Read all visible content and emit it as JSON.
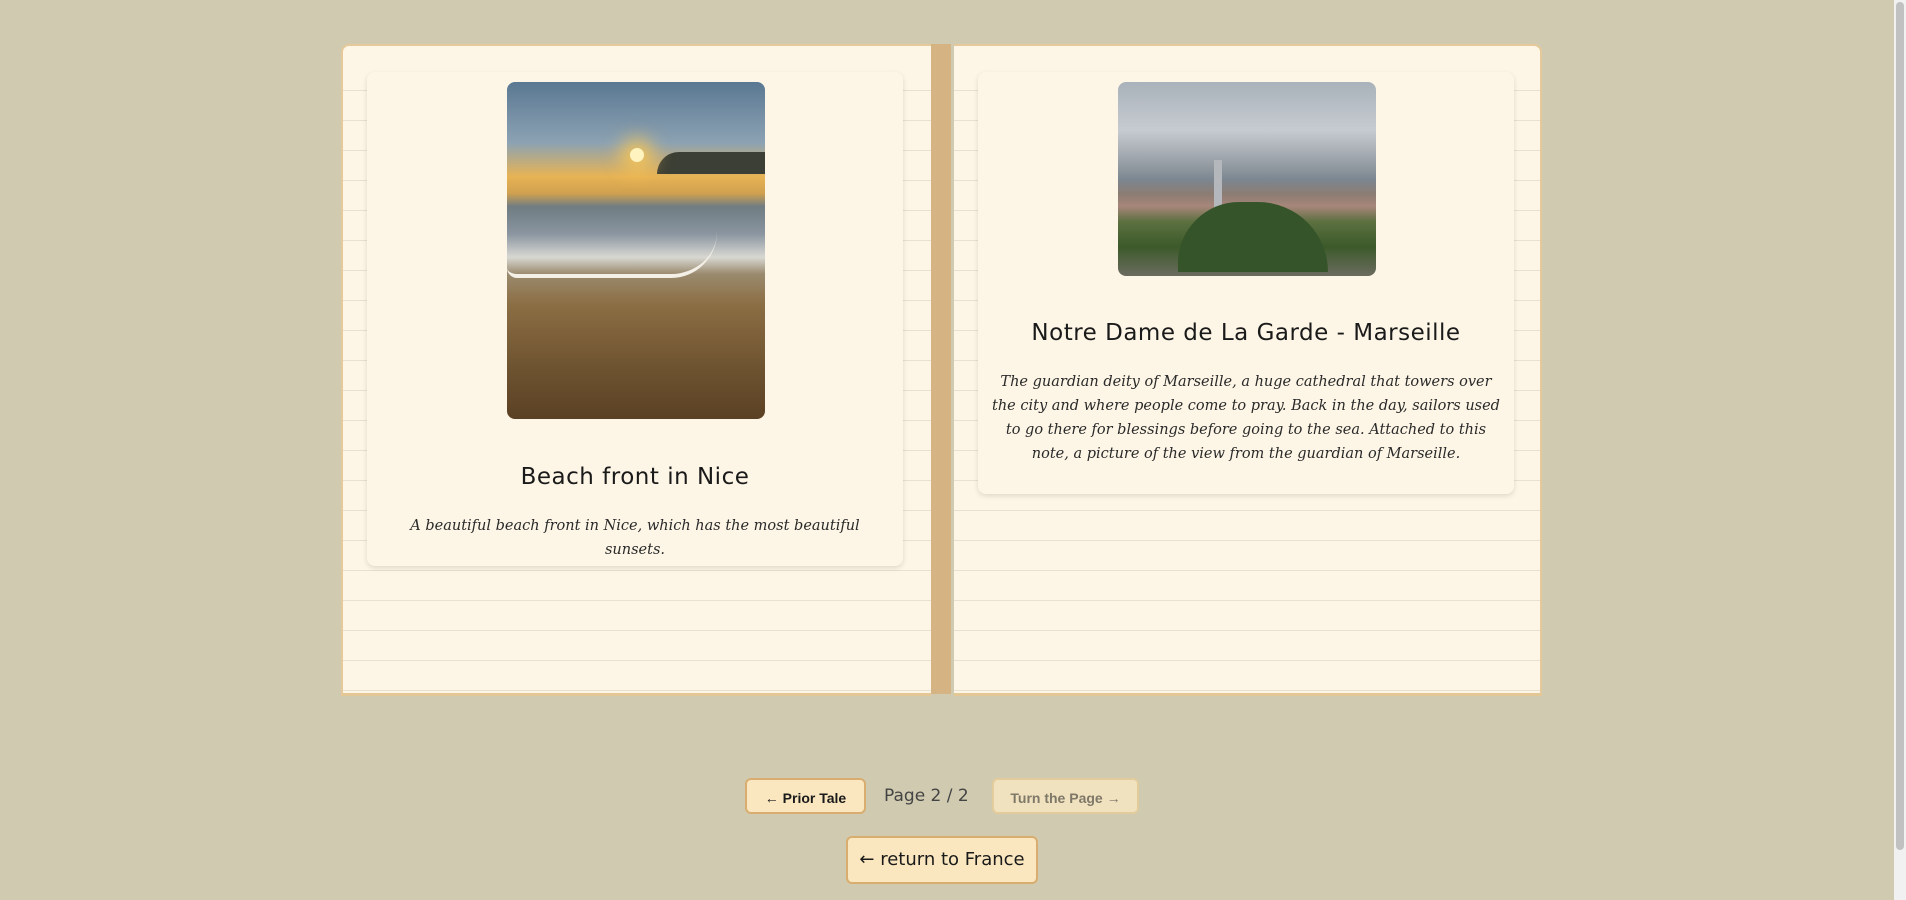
{
  "cards": [
    {
      "title": "Beach front in Nice",
      "description": "A beautiful beach front in Nice, which has the most beautiful sunsets."
    },
    {
      "title": "Notre Dame de La Garde - Marseille",
      "description": "The guardian deity of Marseille, a huge cathedral that towers over the city and where people come to pray. Back in the day, sailors used to go there for blessings before going to the sea. Attached to this note, a picture of the view from the guardian of Marseille."
    }
  ],
  "navigation": {
    "prior_label": "← Prior Tale",
    "page_indicator": "Page 2 / 2",
    "next_label": "Turn the Page →",
    "return_label": "← return to France"
  },
  "colors": {
    "background": "#d0cbb0",
    "page": "#fdf6e6",
    "spine": "#d6b383",
    "button": "#fbe7bf",
    "button_border": "#d9ad6f"
  }
}
